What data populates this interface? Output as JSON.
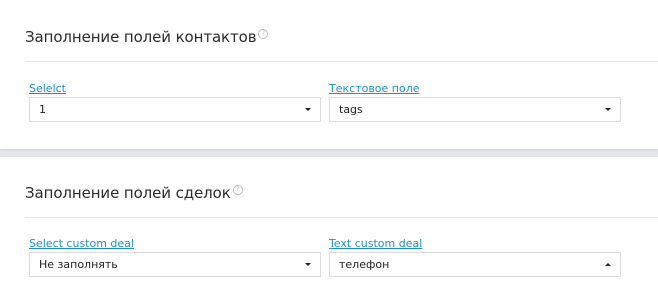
{
  "contacts": {
    "title": "Заполнение полей контактов",
    "help_icon": "help-circle-icon",
    "fields": [
      {
        "label": "Selelct",
        "value": "1",
        "caret": "chevron-down-icon"
      },
      {
        "label": "Текстовое поле",
        "value": "tags",
        "caret": "chevron-down-icon"
      }
    ]
  },
  "deals": {
    "title": "Заполнение полей сделок",
    "help_icon": "help-circle-icon",
    "fields": [
      {
        "label": "Select custom deal",
        "value": "Не заполнять",
        "caret": "chevron-down-icon"
      },
      {
        "label": "Text custom deal",
        "value": "телефон",
        "caret": "chevron-up-icon"
      }
    ]
  },
  "colors": {
    "label_link": "#1a8fd6",
    "background": "#e6e7ea",
    "card": "#ffffff"
  }
}
